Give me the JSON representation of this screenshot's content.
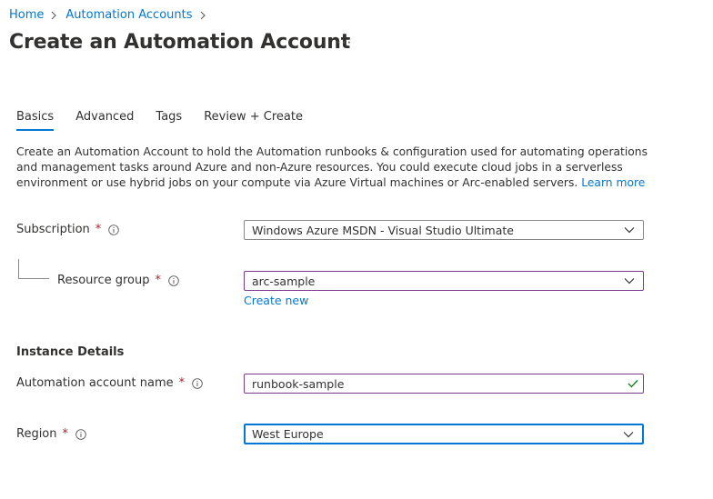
{
  "breadcrumb": {
    "items": [
      "Home",
      "Automation Accounts"
    ]
  },
  "page": {
    "title": "Create an Automation Account",
    "more": "···"
  },
  "tabs": [
    {
      "label": "Basics",
      "active": true
    },
    {
      "label": "Advanced",
      "active": false
    },
    {
      "label": "Tags",
      "active": false
    },
    {
      "label": "Review + Create",
      "active": false
    }
  ],
  "description": {
    "text": "Create an Automation Account to hold the Automation runbooks & configuration used for automating operations and management tasks around Azure and non-Azure resources. You could execute cloud jobs in a serverless environment or use hybrid jobs on your compute via Azure Virtual machines or Arc-enabled servers.",
    "link": "Learn more"
  },
  "form": {
    "required_marker": "*",
    "subscription": {
      "label": "Subscription",
      "value": "Windows Azure MSDN - Visual Studio Ultimate"
    },
    "resource_group": {
      "label": "Resource group",
      "value": "arc-sample",
      "create_new": "Create new"
    },
    "instance_details": {
      "title": "Instance Details"
    },
    "account_name": {
      "label": "Automation account name",
      "value": "runbook-sample"
    },
    "region": {
      "label": "Region",
      "value": "West Europe"
    }
  },
  "colors": {
    "accent": "#0078d4",
    "required": "#a4262c",
    "valid": "#107c10"
  }
}
